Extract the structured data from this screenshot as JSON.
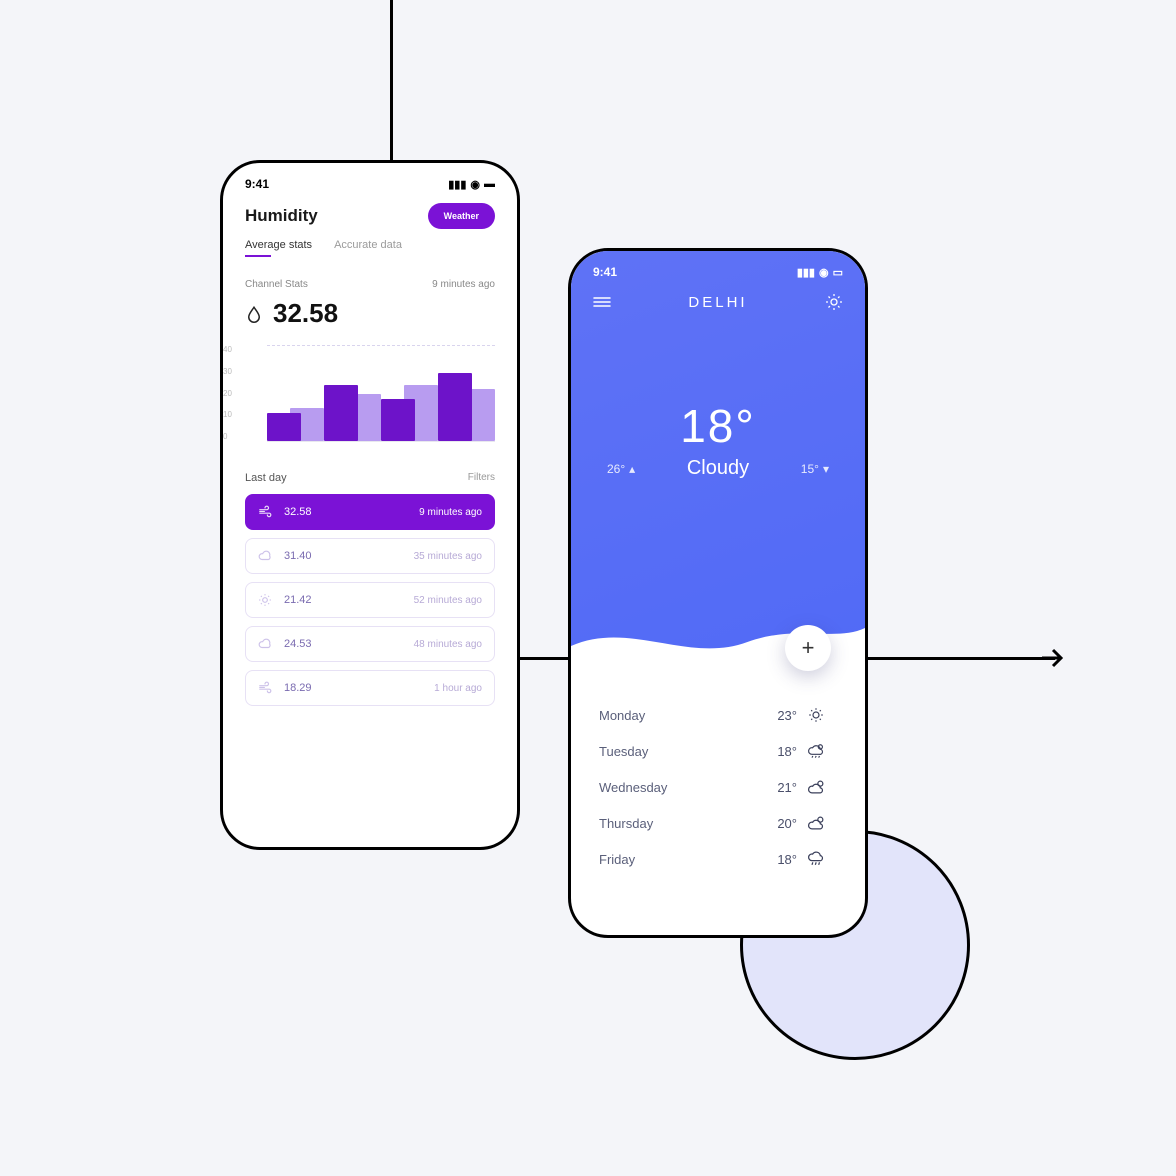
{
  "statusbar": {
    "time": "9:41"
  },
  "humidity": {
    "title": "Humidity",
    "weather_btn": "Weather",
    "tabs": [
      "Average stats",
      "Accurate data"
    ],
    "section_label": "Channel Stats",
    "section_time": "9 minutes ago",
    "big_value": "32.58",
    "lastday_label": "Last day",
    "filters_label": "Filters",
    "rows": [
      {
        "icon": "wind",
        "value": "32.58",
        "time": "9 minutes ago",
        "active": true
      },
      {
        "icon": "cloud",
        "value": "31.40",
        "time": "35 minutes ago",
        "active": false
      },
      {
        "icon": "sun",
        "value": "21.42",
        "time": "52 minutes ago",
        "active": false
      },
      {
        "icon": "cloud",
        "value": "24.53",
        "time": "48 minutes ago",
        "active": false
      },
      {
        "icon": "wind",
        "value": "18.29",
        "time": "1 hour ago",
        "active": false
      }
    ]
  },
  "weather": {
    "city": "DELHI",
    "temp": "18°",
    "condition": "Cloudy",
    "high": "26°",
    "low": "15°",
    "forecast": [
      {
        "day": "Monday",
        "temp": "23°",
        "icon": "sun"
      },
      {
        "day": "Tuesday",
        "temp": "18°",
        "icon": "rain-sun"
      },
      {
        "day": "Wednesday",
        "temp": "21°",
        "icon": "cloud-sun"
      },
      {
        "day": "Thursday",
        "temp": "20°",
        "icon": "cloud-sun"
      },
      {
        "day": "Friday",
        "temp": "18°",
        "icon": "rain"
      }
    ]
  },
  "chart_data": {
    "type": "bar",
    "ylabels": [
      "40",
      "30",
      "20",
      "10",
      "0"
    ],
    "ylim": [
      0,
      40
    ],
    "series": [
      {
        "name": "front",
        "color": "#6d13c9",
        "values": [
          12,
          24,
          18,
          29
        ]
      },
      {
        "name": "back",
        "color": "#b89cf0",
        "values": [
          14,
          20,
          24,
          22
        ]
      }
    ]
  }
}
